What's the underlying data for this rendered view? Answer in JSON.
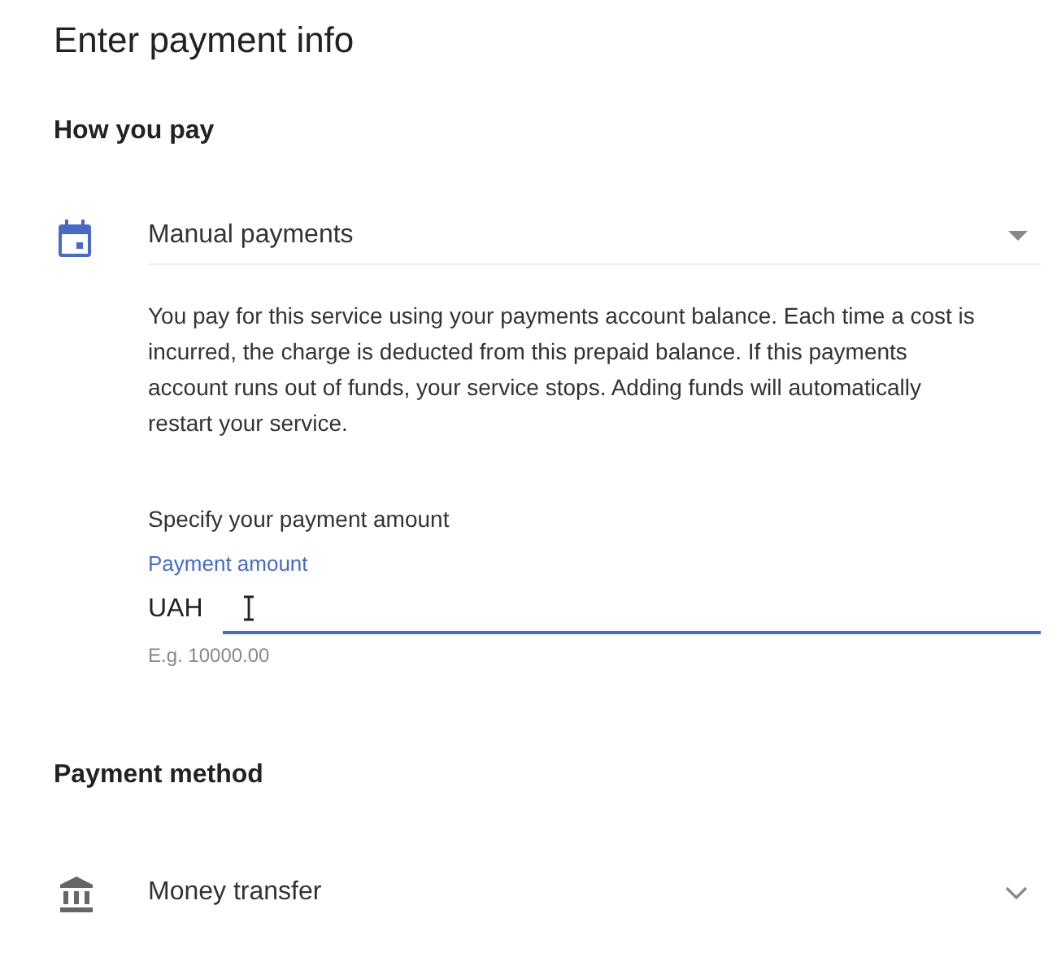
{
  "title": "Enter payment info",
  "sections": [
    {
      "heading": "How you pay",
      "icon": {
        "kind": "calendar"
      },
      "select": {
        "kind": "triangle",
        "value": "Manual payments"
      },
      "description": "You pay for this service using your payments account balance. Each time a cost is incurred, the charge is deducted from this prepaid balance. If this payments account runs out of funds, your service stops. Adding funds will automatically restart your service.",
      "amount": {
        "prompt": "Specify your payment amount",
        "label": "Payment amount",
        "prefix": "UAH",
        "hint": "E.g. 10000.00",
        "focused": true
      }
    },
    {
      "heading": "Payment method",
      "icon": {
        "kind": "bank"
      },
      "select": {
        "kind": "chevron",
        "value": "Money transfer"
      }
    }
  ]
}
